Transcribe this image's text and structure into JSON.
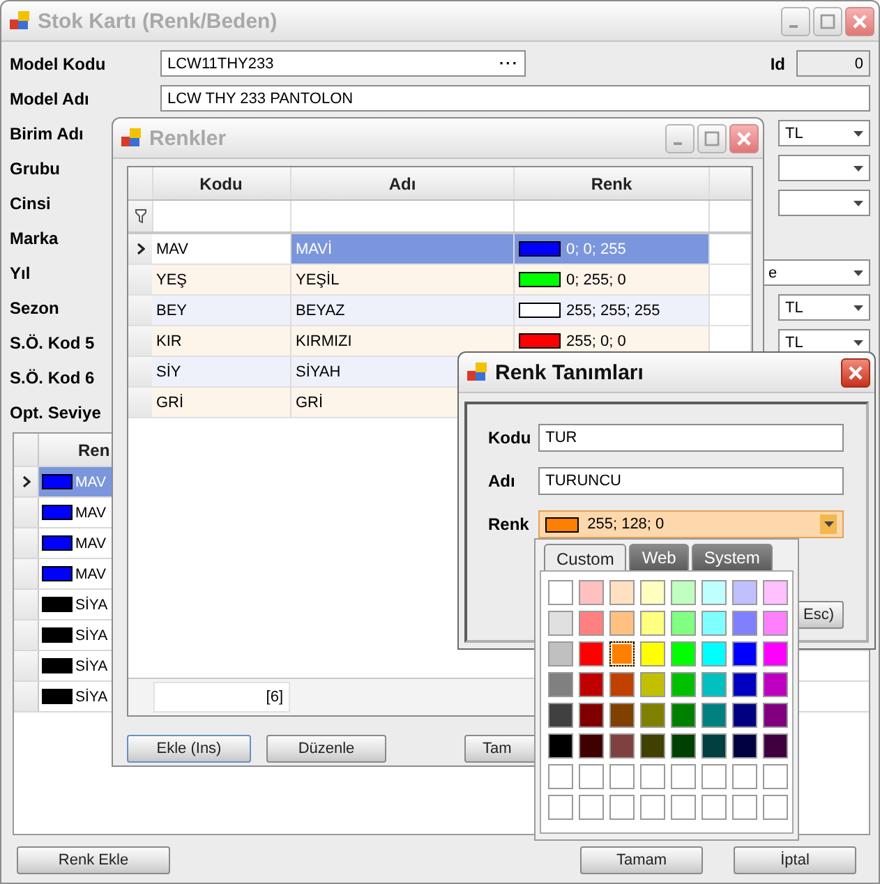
{
  "main_window": {
    "title": "Stok Kartı (Renk/Beden)",
    "form": [
      {
        "kind": "lookup",
        "label": "Model Kodu",
        "value": "LCW11THY233",
        "button": "···",
        "id_label": "Id",
        "id_value": "0"
      },
      {
        "kind": "text",
        "label": "Model Adı",
        "value": "LCW THY 233 PANTOLON"
      },
      {
        "kind": "combo",
        "label": "Birim Adı",
        "value": "TL"
      },
      {
        "kind": "combo",
        "label": "Grubu"
      },
      {
        "kind": "combo",
        "label": "Cinsi"
      },
      {
        "kind": "label",
        "label": "Marka"
      },
      {
        "kind": "wide_combo",
        "label": "Yıl",
        "value": "e"
      },
      {
        "kind": "combo",
        "label": "Sezon",
        "value": "TL"
      },
      {
        "kind": "combo",
        "label": "S.Ö. Kod 5",
        "value": "TL"
      },
      {
        "kind": "label",
        "label": "S.Ö. Kod 6"
      },
      {
        "kind": "label",
        "label": "Opt. Seviye"
      }
    ],
    "color_grid": {
      "column": "Ren",
      "rows": [
        {
          "text": "MAV",
          "color": "#0000ff",
          "selected": true
        },
        {
          "text": "MAV",
          "color": "#0000ff",
          "selected": false
        },
        {
          "text": "MAV",
          "color": "#0000ff",
          "selected": false
        },
        {
          "text": "MAV",
          "color": "#0000ff",
          "selected": false
        },
        {
          "text": "SİYA",
          "color": "#000000",
          "selected": false
        },
        {
          "text": "SİYA",
          "color": "#000000",
          "selected": false
        },
        {
          "text": "SİYA",
          "color": "#000000",
          "selected": false
        },
        {
          "text": "SİYA",
          "color": "#000000",
          "selected": false
        }
      ]
    },
    "buttons": [
      "Renk Ekle",
      "Tamam",
      "İptal"
    ]
  },
  "renkler_window": {
    "title": "Renkler",
    "columns": [
      "Kodu",
      "Adı",
      "Renk"
    ],
    "rows": [
      {
        "kodu": "MAV",
        "adi": "MAVİ",
        "renk": "0; 0; 255",
        "color": "#0000ff",
        "selected": true
      },
      {
        "kodu": "YEŞ",
        "adi": "YEŞİL",
        "renk": "0; 255; 0",
        "color": "#00ff00",
        "selected": false
      },
      {
        "kodu": "BEY",
        "adi": "BEYAZ",
        "renk": "255; 255; 255",
        "color": "#ffffff",
        "selected": false
      },
      {
        "kodu": "KIR",
        "adi": "KIRMIZI",
        "renk": "255; 0; 0",
        "color": "#ff0000",
        "selected": false
      },
      {
        "kodu": "SİY",
        "adi": "SİYAH",
        "selected": false
      },
      {
        "kodu": "GRİ",
        "adi": "GRİ",
        "selected": false
      }
    ],
    "footer_count": "[6]",
    "buttons": [
      "Ekle (Ins)",
      "Düzenle",
      "Tam"
    ]
  },
  "renk_tanimlari_dialog": {
    "title": "Renk Tanımları",
    "fields": [
      {
        "kind": "text",
        "label": "Kodu",
        "value": "TUR"
      },
      {
        "kind": "text",
        "label": "Adı",
        "value": "TURUNCU"
      },
      {
        "kind": "color",
        "label": "Renk",
        "value": "255; 128; 0",
        "color": "#ff8000"
      }
    ],
    "button": "Esc)"
  },
  "color_popup": {
    "tabs": [
      {
        "label": "Custom",
        "selected": true
      },
      {
        "label": "Web",
        "selected": false
      },
      {
        "label": "System",
        "selected": false
      }
    ],
    "swatches": [
      [
        {
          "kind": "color",
          "color": "#ffffff",
          "selected": false
        },
        {
          "kind": "color",
          "color": "#ffc0c0",
          "selected": false
        },
        {
          "kind": "color",
          "color": "#ffe0c0",
          "selected": false
        },
        {
          "kind": "color",
          "color": "#ffffc0",
          "selected": false
        },
        {
          "kind": "color",
          "color": "#c0ffc0",
          "selected": false
        },
        {
          "kind": "color",
          "color": "#c0ffff",
          "selected": false
        },
        {
          "kind": "color",
          "color": "#c0c0ff",
          "selected": false
        },
        {
          "kind": "color",
          "color": "#ffc0ff",
          "selected": false
        }
      ],
      [
        {
          "kind": "color",
          "color": "#e0e0e0",
          "selected": false
        },
        {
          "kind": "color",
          "color": "#ff8080",
          "selected": false
        },
        {
          "kind": "color",
          "color": "#ffc080",
          "selected": false
        },
        {
          "kind": "color",
          "color": "#ffff80",
          "selected": false
        },
        {
          "kind": "color",
          "color": "#80ff80",
          "selected": false
        },
        {
          "kind": "color",
          "color": "#80ffff",
          "selected": false
        },
        {
          "kind": "color",
          "color": "#8080ff",
          "selected": false
        },
        {
          "kind": "color",
          "color": "#ff80ff",
          "selected": false
        }
      ],
      [
        {
          "kind": "color",
          "color": "#c0c0c0",
          "selected": false
        },
        {
          "kind": "color",
          "color": "#ff0000",
          "selected": false
        },
        {
          "kind": "color",
          "color": "#ff8000",
          "selected": true
        },
        {
          "kind": "color",
          "color": "#ffff00",
          "selected": false
        },
        {
          "kind": "color",
          "color": "#00ff00",
          "selected": false
        },
        {
          "kind": "color",
          "color": "#00ffff",
          "selected": false
        },
        {
          "kind": "color",
          "color": "#0000ff",
          "selected": false
        },
        {
          "kind": "color",
          "color": "#ff00ff",
          "selected": false
        }
      ],
      [
        {
          "kind": "color",
          "color": "#808080",
          "selected": false
        },
        {
          "kind": "color",
          "color": "#c00000",
          "selected": false
        },
        {
          "kind": "color",
          "color": "#c04000",
          "selected": false
        },
        {
          "kind": "color",
          "color": "#c0c000",
          "selected": false
        },
        {
          "kind": "color",
          "color": "#00c000",
          "selected": false
        },
        {
          "kind": "color",
          "color": "#00c0c0",
          "selected": false
        },
        {
          "kind": "color",
          "color": "#0000c0",
          "selected": false
        },
        {
          "kind": "color",
          "color": "#c000c0",
          "selected": false
        }
      ],
      [
        {
          "kind": "color",
          "color": "#404040",
          "selected": false
        },
        {
          "kind": "color",
          "color": "#800000",
          "selected": false
        },
        {
          "kind": "color",
          "color": "#804000",
          "selected": false
        },
        {
          "kind": "color",
          "color": "#808000",
          "selected": false
        },
        {
          "kind": "color",
          "color": "#008000",
          "selected": false
        },
        {
          "kind": "color",
          "color": "#008080",
          "selected": false
        },
        {
          "kind": "color",
          "color": "#000080",
          "selected": false
        },
        {
          "kind": "color",
          "color": "#800080",
          "selected": false
        }
      ],
      [
        {
          "kind": "color",
          "color": "#000000",
          "selected": false
        },
        {
          "kind": "color",
          "color": "#400000",
          "selected": false
        },
        {
          "kind": "color",
          "color": "#804040",
          "selected": false
        },
        {
          "kind": "color",
          "color": "#404000",
          "selected": false
        },
        {
          "kind": "color",
          "color": "#004000",
          "selected": false
        },
        {
          "kind": "color",
          "color": "#004040",
          "selected": false
        },
        {
          "kind": "color",
          "color": "#000040",
          "selected": false
        },
        {
          "kind": "color",
          "color": "#400040",
          "selected": false
        }
      ],
      [
        {
          "kind": "empty",
          "selected": false
        },
        {
          "kind": "empty",
          "selected": false
        },
        {
          "kind": "empty",
          "selected": false
        },
        {
          "kind": "empty",
          "selected": false
        },
        {
          "kind": "empty",
          "selected": false
        },
        {
          "kind": "empty",
          "selected": false
        },
        {
          "kind": "empty",
          "selected": false
        },
        {
          "kind": "empty",
          "selected": false
        }
      ],
      [
        {
          "kind": "empty",
          "selected": false
        },
        {
          "kind": "empty",
          "selected": false
        },
        {
          "kind": "empty",
          "selected": false
        },
        {
          "kind": "empty",
          "selected": false
        },
        {
          "kind": "empty",
          "selected": false
        },
        {
          "kind": "empty",
          "selected": false
        },
        {
          "kind": "empty",
          "selected": false
        },
        {
          "kind": "empty",
          "selected": false
        }
      ]
    ]
  }
}
